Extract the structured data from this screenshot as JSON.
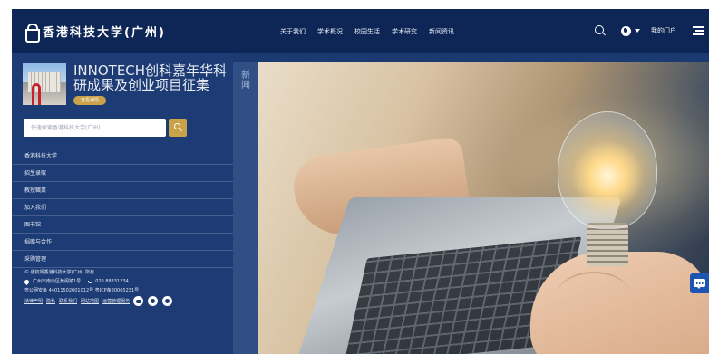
{
  "header": {
    "logo_text": "香港科技大学(广州)",
    "nav": [
      "关于我们",
      "学术概况",
      "校园生活",
      "学术研究",
      "新闻资讯"
    ],
    "portal_label": "我的门户"
  },
  "banner": {
    "title": "INNOTECH创科嘉年华科研成果及创业项目征集",
    "button_label": "查看详情"
  },
  "search": {
    "placeholder": "快速探索香港科技大学(广州)"
  },
  "sidebar": {
    "items": [
      {
        "label": "香港科技大学"
      },
      {
        "label": "招生录取"
      },
      {
        "label": "教授職業"
      },
      {
        "label": "加入我们"
      },
      {
        "label": "图书馆"
      },
      {
        "label": "捐赠与合作"
      },
      {
        "label": "采购管理"
      }
    ]
  },
  "footer": {
    "copyright": "© 版权属香港科技大学(广州) 所有",
    "address": "广州市南沙区黄阁镇1号",
    "phone": "020 88331234",
    "icp": "粤公网安备 44011502001012号  粤ICP备20065231号",
    "links": [
      "法律声明",
      "隐私",
      "联系我们",
      "网站地图",
      "运营管理服务"
    ]
  },
  "news_label": "新闻",
  "colors": {
    "topbar": "#0d2655",
    "panel": "#1d3b74",
    "accent_gold": "#c9a24a",
    "chat_button": "#1e55b3"
  },
  "icons": [
    "logo-icon",
    "search-icon",
    "globe-icon",
    "caret-down-icon",
    "menu-icon",
    "location-pin-icon",
    "phone-icon",
    "wechat-icon",
    "weibo-icon",
    "video-icon",
    "chat-icon"
  ]
}
